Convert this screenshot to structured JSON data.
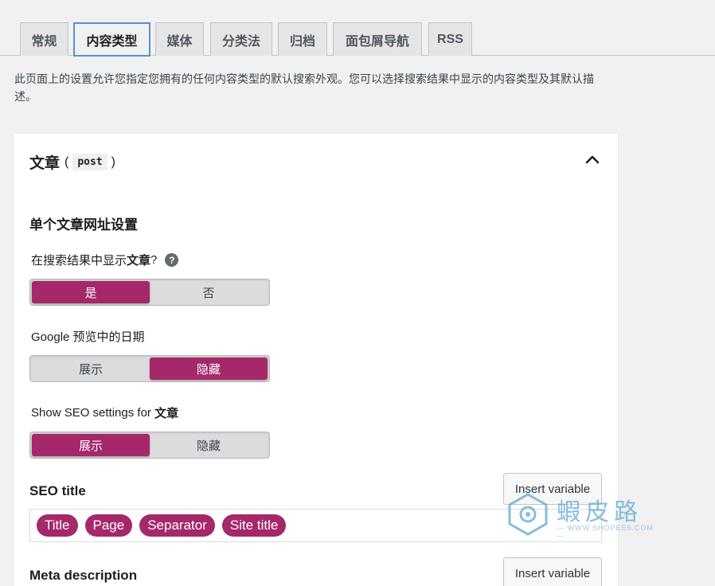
{
  "tabs": [
    {
      "label": "常规"
    },
    {
      "label": "内容类型"
    },
    {
      "label": "媒体"
    },
    {
      "label": "分类法"
    },
    {
      "label": "归档"
    },
    {
      "label": "面包屑导航"
    },
    {
      "label": "RSS"
    }
  ],
  "active_tab": "内容类型",
  "intro": "此页面上的设置允许您指定您拥有的任何内容类型的默认搜索外观。您可以选择搜索结果中显示的内容类型及其默认描述。",
  "panel": {
    "title": "文章",
    "paren_open": "(",
    "slug": "post",
    "paren_close": ")",
    "section_title": "单个文章网址设置",
    "show_in_results": {
      "label_prefix": "在搜索结果中显示",
      "label_bold": "文章",
      "label_suffix": "?",
      "help": "?",
      "options": [
        "是",
        "否"
      ],
      "selected": "是"
    },
    "date_in_preview": {
      "label": "Google 预览中的日期",
      "options": [
        "展示",
        "隐藏"
      ],
      "selected": "隐藏"
    },
    "show_seo_settings": {
      "label_prefix": "Show SEO settings for ",
      "label_bold": "文章",
      "options": [
        "展示",
        "隐藏"
      ],
      "selected": "展示"
    },
    "seo_title": {
      "label": "SEO title",
      "insert_label": "Insert variable",
      "pills": [
        "Title",
        "Page",
        "Separator",
        "Site title"
      ]
    },
    "meta_description": {
      "label": "Meta description",
      "insert_label": "Insert variable"
    }
  },
  "watermark": {
    "text": "蝦皮路",
    "sub": "— WWW.SHOPEE6.COM —"
  },
  "colors": {
    "accent": "#a4286a",
    "tab_focus": "#4f94d4"
  }
}
